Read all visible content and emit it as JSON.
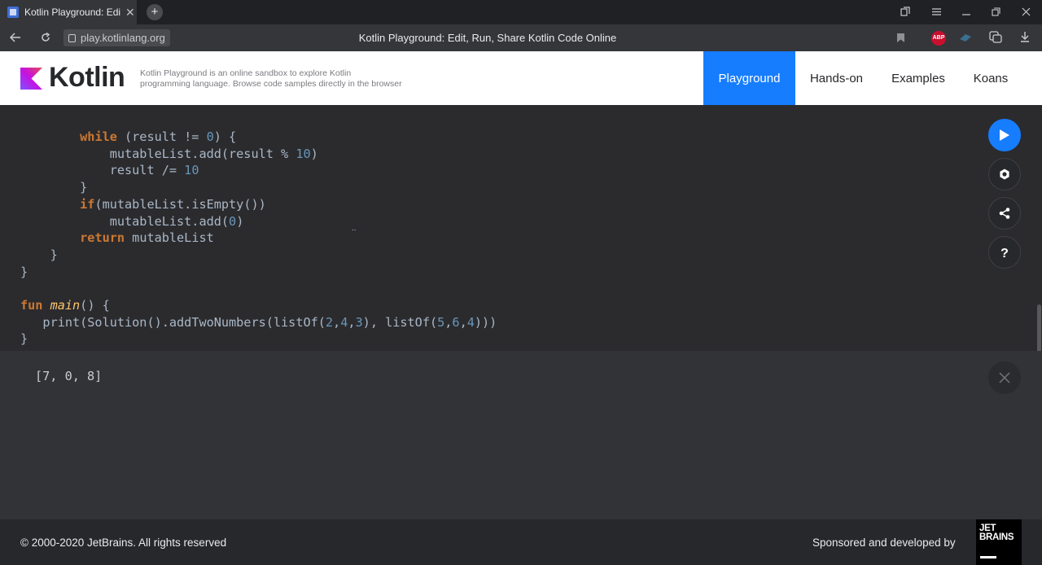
{
  "browser": {
    "tab_title": "Kotlin Playground: Edit,",
    "tab_close": "✕",
    "newtab": "+",
    "url": "play.kotlinlang.org",
    "page_title": "Kotlin Playground: Edit, Run, Share Kotlin Code Online",
    "abp_label": "ABP"
  },
  "header": {
    "brand": "Kotlin",
    "tagline_line1": "Kotlin Playground is an online sandbox to explore Kotlin",
    "tagline_line2": "programming language. Browse code samples directly in the browser",
    "nav": [
      "Playground",
      "Hands-on",
      "Examples",
      "Koans"
    ],
    "active_nav": "Playground",
    "brand_colors": [
      "#7f52ff",
      "#e44857",
      "#167dff"
    ]
  },
  "editor": {
    "lines": [
      "        while (result != 0) {",
      "            mutableList.add(result % 10)",
      "            result /= 10",
      "        }",
      "        if(mutableList.isEmpty())",
      "            mutableList.add(0)",
      "        return mutableList",
      "    }",
      "}",
      "",
      "fun main() {",
      "   print(Solution().addTwoNumbers(listOf(2,4,3), listOf(5,6,4)))",
      "}"
    ],
    "fold_marker": "..",
    "accent_color": "#167dff"
  },
  "output": {
    "text": "[7, 0, 8]"
  },
  "footer": {
    "copyright": "© 2000-2020 JetBrains. All rights reserved",
    "sponsor": "Sponsored and developed by",
    "jb_line1": "JET",
    "jb_line2": "BRAINS"
  }
}
